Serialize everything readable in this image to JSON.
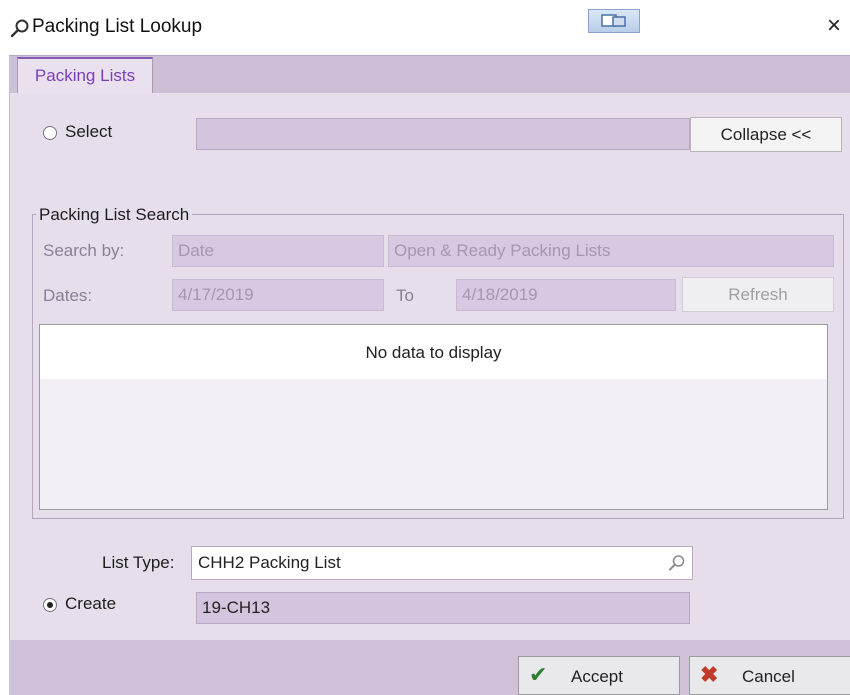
{
  "window": {
    "title": "Packing List Lookup",
    "title_icon": "search-icon",
    "close_label": "×"
  },
  "tabs": [
    {
      "label": "Packing Lists",
      "active": true
    }
  ],
  "select_row": {
    "label": "Select",
    "checked": false,
    "value": "",
    "collapse_label": "Collapse <<"
  },
  "search": {
    "group_title": "Packing List Search",
    "search_by_label": "Search by:",
    "search_by_value": "Date",
    "filter_value": "Open & Ready Packing Lists",
    "dates_label": "Dates:",
    "date_from": "4/17/2019",
    "to_label": "To",
    "date_to": "4/18/2019",
    "refresh_label": "Refresh",
    "grid_empty_message": "No data to display"
  },
  "list_type": {
    "label": "List Type:",
    "value": "CHH2 Packing List"
  },
  "create_row": {
    "label": "Create",
    "checked": true,
    "value": "19-CH13"
  },
  "footer": {
    "accept_label": "Accept",
    "accept_icon": "checkmark-icon",
    "cancel_label": "Cancel",
    "cancel_icon": "x-icon"
  },
  "colors": {
    "accent": "#8659b5",
    "panel": "#e6dfeb",
    "field": "#d3c5de",
    "check": "#2e7d32",
    "cancel": "#c0392b"
  }
}
